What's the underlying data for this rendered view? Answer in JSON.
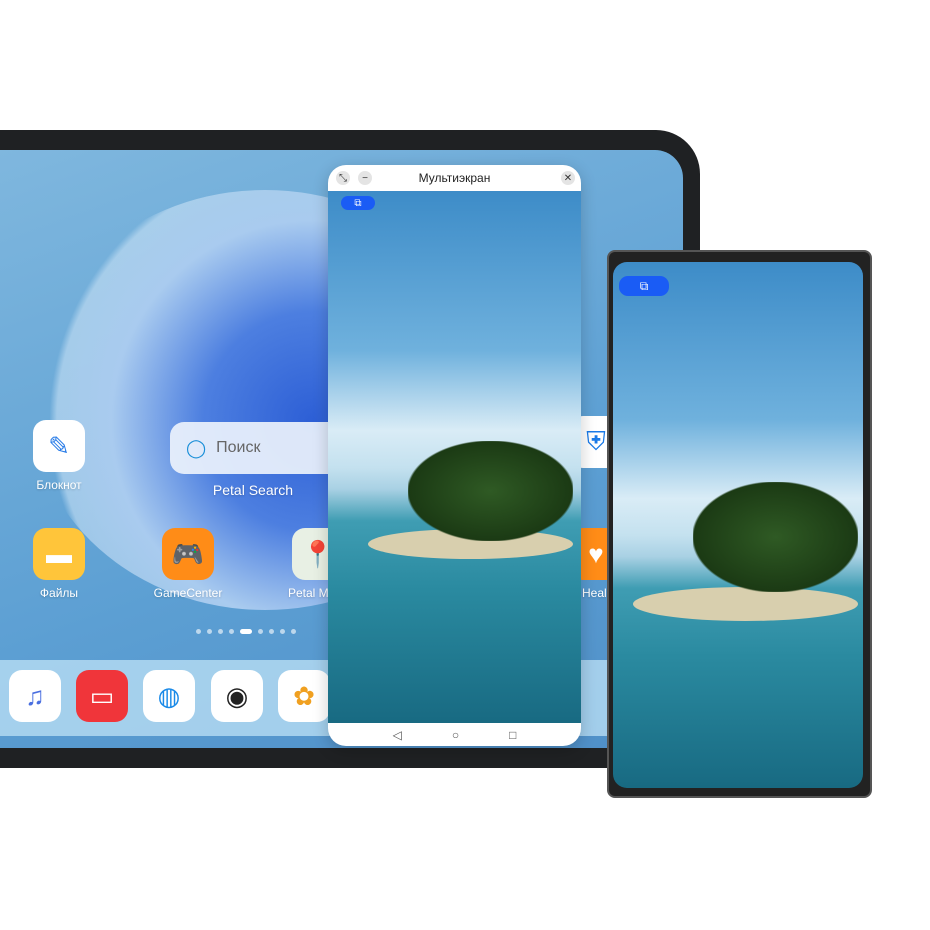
{
  "tablet": {
    "search": {
      "placeholder": "Поиск",
      "widget_label": "Petal Search"
    },
    "apps": [
      {
        "label": "Блокнот",
        "icon": "notepad-icon"
      },
      {
        "label": "Файлы",
        "icon": "files-icon"
      },
      {
        "label": "GameCenter",
        "icon": "gamepad-icon"
      },
      {
        "label": "Petal M",
        "icon": "map-pin-icon"
      },
      {
        "label": "Heal",
        "icon": "health-icon"
      }
    ],
    "dock": [
      "music-icon",
      "books-icon",
      "browser-icon",
      "camera-icon",
      "gallery-icon"
    ],
    "page_dots": {
      "count": 9,
      "active": 4
    }
  },
  "window": {
    "title": "Мультиэкран",
    "buttons": [
      "expand-icon",
      "minimize-icon",
      "close-icon"
    ],
    "badge_icon": "multi-device-icon",
    "nav": [
      "back-icon",
      "home-icon",
      "recents-icon"
    ]
  },
  "phone": {
    "badge_icon": "multi-device-icon"
  },
  "colors": {
    "accent": "#1a5cf5",
    "frame": "#1f2123"
  }
}
